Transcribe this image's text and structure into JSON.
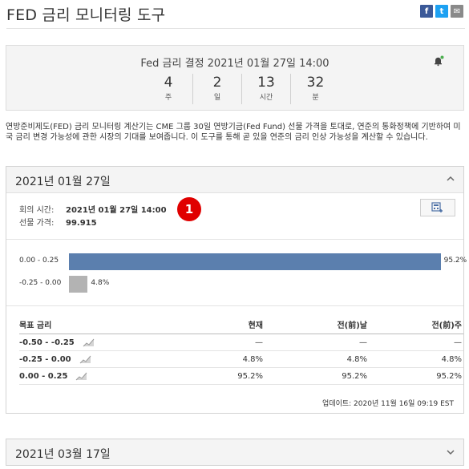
{
  "page": {
    "title": "FED 금리 모니터링 도구"
  },
  "share": {
    "facebook": "f",
    "twitter": "t",
    "mail": "✉"
  },
  "countdown": {
    "title": "Fed 금리 결정 2021년 01월 27일 14:00",
    "units": [
      {
        "value": "4",
        "label": "주"
      },
      {
        "value": "2",
        "label": "일"
      },
      {
        "value": "13",
        "label": "시간"
      },
      {
        "value": "32",
        "label": "분"
      }
    ]
  },
  "description": "연방준비제도(FED) 금리 모니터링 계산기는 CME 그룹 30일 연방기금(Fed Fund) 선물 가격을 토대로, 연준의 통화정책에 기반하여 미국 금리 변경 가능성에 관한 시장의 기대를 보여줍니다. 이 도구를 통해 곧 있을 연준의 금리 인상 가능성을 계산할 수 있습니다.",
  "meeting": {
    "date_header": "2021년 01월 27일",
    "time_label": "회의 시간:",
    "time_value": "2021년 01월 27일 14:00",
    "price_label": "선물 가격:",
    "price_value": "99.915",
    "badge": "1"
  },
  "chart_data": {
    "type": "bar",
    "orientation": "horizontal",
    "categories": [
      "0.00 - 0.25",
      "-0.25 - 0.00"
    ],
    "values": [
      95.2,
      4.8
    ],
    "value_labels": [
      "95.2%",
      "4.8%"
    ],
    "colors": [
      "#5b7fae",
      "#b3b3b3"
    ],
    "xlim": [
      0,
      100
    ]
  },
  "table": {
    "headers": [
      "목표 금리",
      "현재",
      "전(前)날",
      "전(前)주"
    ],
    "rows": [
      {
        "rate": "-0.50 - -0.25",
        "current": "—",
        "prev_day": "—",
        "prev_week": "—"
      },
      {
        "rate": "-0.25 - 0.00",
        "current": "4.8%",
        "prev_day": "4.8%",
        "prev_week": "4.8%"
      },
      {
        "rate": "0.00 - 0.25",
        "current": "95.2%",
        "prev_day": "95.2%",
        "prev_week": "95.2%"
      }
    ]
  },
  "updated": "업데이트: 2020년 11월 16일 09:19 EST",
  "next_meeting": {
    "date_header": "2021년 03월 17일"
  }
}
